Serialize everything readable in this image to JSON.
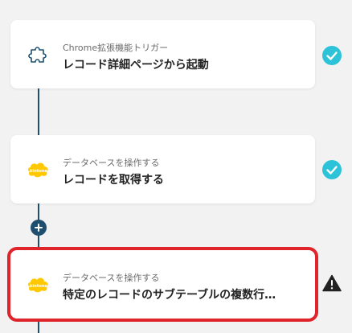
{
  "flow": {
    "steps": [
      {
        "subtitle": "Chrome拡張機能トリガー",
        "title": "レコード詳細ページから起動",
        "icon": "puzzle-piece-icon",
        "status": "check-icon"
      },
      {
        "subtitle": "データベースを操作する",
        "title": "レコードを取得する",
        "icon": "kintone-logo",
        "icon_text": "kintone",
        "status": "check-icon"
      },
      {
        "subtitle": "データベースを操作する",
        "title": "特定のレコードのサブテーブルの複数行…",
        "icon": "kintone-logo",
        "icon_text": "kintone",
        "status": "warning-icon"
      }
    ],
    "add_icon": "plus-icon"
  },
  "colors": {
    "connector": "#1f4e6e",
    "check": "#2cc3d8",
    "warning": "#222222",
    "kintone": "#ffc800",
    "selected_outline": "#e0242b"
  }
}
